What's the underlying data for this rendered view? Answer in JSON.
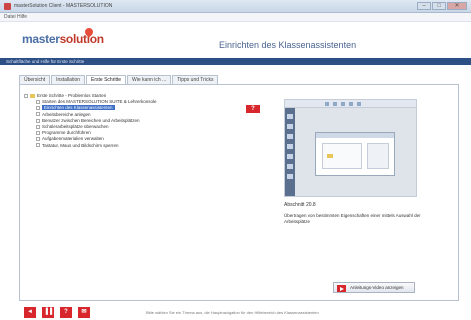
{
  "window": {
    "title": "masterSolution Client - MASTERSOLUTION",
    "menu_label": "Datei Hilfe",
    "controls": {
      "minimize": "–",
      "maximize": "□",
      "close": "✕"
    }
  },
  "header": {
    "logo_primary": "master",
    "logo_accent": "solution",
    "title": "Einrichten des Klassenassistenten"
  },
  "subbar": {
    "text": "Schaltfläche und Hilfe für Erste Schritte"
  },
  "tabs": [
    {
      "label": "Übersicht"
    },
    {
      "label": "Installation"
    },
    {
      "label": "Erste Schritte"
    },
    {
      "label": "Wie kann ich ..."
    },
    {
      "label": "Tipps und Tricks"
    }
  ],
  "tree": {
    "root": "Erste Schritte - Problemlos Starten",
    "items": [
      "Starten des MASTERSOLUTION SUITE & Lehrerkonsole",
      "Einrichten des Klassenassistenten",
      "Arbeitsbereiche anlegen",
      "Benutzer zwischen Bereichen und Arbeitsplätzen",
      "Schülerarbeitsplätze überwachen",
      "Programme durchführen",
      "Aufgabenmaterialien verwalten",
      "Tastatur, Maus und Bildschirm sperren"
    ],
    "selected_index": 1
  },
  "help_badge": "?",
  "preview": {
    "caption": "Abschnitt 20.8",
    "description": "Übertragen von bestimmten Eigenschaften einer mittels Auswahl der Arbeitsplätze"
  },
  "video_button": {
    "label": "Anleitungs-Video anzeigen"
  },
  "footer": {
    "nav": [
      "◄",
      "▐▐",
      "?",
      "✉"
    ],
    "note": "Bitte wählen Sie ein Thema aus, die Hauptnavigation für den Hilfebereich des Klassenassistenten"
  },
  "colors": {
    "brand_blue": "#2c4f86",
    "accent_red": "#d8262d",
    "selection": "#3d6fc6"
  }
}
